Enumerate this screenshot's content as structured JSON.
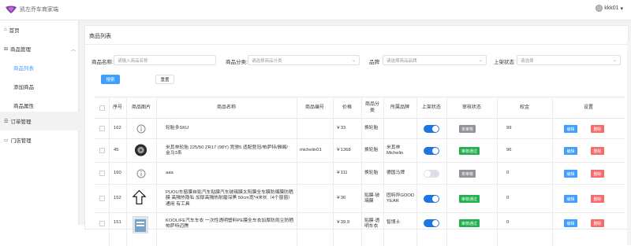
{
  "app": {
    "title": "凯左乔车商家端",
    "user": "kkk01"
  },
  "sidebar": {
    "items": [
      {
        "label": "首页",
        "icon": "home-icon"
      },
      {
        "label": "商品管理",
        "icon": "goods-icon"
      },
      {
        "label": "商品列表"
      },
      {
        "label": "添加商品"
      },
      {
        "label": "商品属性"
      },
      {
        "label": "订单管理",
        "icon": "order-icon"
      },
      {
        "label": "门店管理",
        "icon": "store-icon"
      }
    ]
  },
  "panel": {
    "title": "商品列表"
  },
  "filters": {
    "name_label": "商品名称:",
    "name_placeholder": "请输入商品名称",
    "category_label": "商品分类:",
    "category_placeholder": "请选择商品分类",
    "brand_label": "品牌",
    "brand_placeholder": "请选择商品品牌",
    "status_label": "上架状态",
    "status_placeholder": "请选择",
    "search_button": "搜索",
    "reset_button": "重置"
  },
  "table": {
    "columns": [
      "序号",
      "商品图片",
      "商品名称",
      "商品编号",
      "价格",
      "商品分类",
      "所属品牌",
      "上架状态",
      "审核状态",
      "权金",
      "设置"
    ],
    "rows": [
      {
        "id": "162",
        "name": "轮胎多SKU",
        "code": "",
        "price": "￥33",
        "category": "换轮胎",
        "brand": "",
        "on": true,
        "audit": "未审核",
        "audit_type": "gray",
        "quan": "99",
        "thumb": "info-circle-icon"
      },
      {
        "id": "45",
        "name": "米其林轮胎 225/50 ZR17 (98Y) 竞驰5 适配登冠/帕萨特/雅阁/金马3系",
        "code": "michelin01",
        "price": "￥1368",
        "category": "换轮胎",
        "brand": "米其林Michelin",
        "on": true,
        "audit": "审核通过",
        "audit_type": "green",
        "quan": "96",
        "thumb": "tire-icon"
      },
      {
        "id": "160",
        "name": "aaa",
        "code": "",
        "price": "￥111",
        "category": "换轮胎",
        "brand": "德国马牌",
        "on": false,
        "audit": "未审核",
        "audit_type": "gray",
        "quan": "0",
        "thumb": "info-circle-icon"
      },
      {
        "id": "152",
        "name": "PUOU车窗膜自贴汽车贴膜汽车玻璃膜太阳膜全车膜防爆膜防晒膜 高隔热隐私 加厚高隔热耐磨深黑 50cm宽*4米长（4个窗窗）通用 有工具",
        "code": "",
        "price": "￥36",
        "category": "贴膜-玻璃膜",
        "brand": "固特异GOOD YEAR",
        "on": true,
        "audit": "审核通过",
        "audit_type": "green",
        "quan": "0",
        "thumb": "arrow-up-icon"
      },
      {
        "id": "151",
        "name": "KOOLIFE汽车车衣 一次性透明塑料PE膜全车衣加厚防雨尘防晒 帕萨特迈腾",
        "code": "",
        "price": "￥39.9",
        "category": "贴膜-透明车衣",
        "brand": "智博士",
        "on": true,
        "audit": "审核通过",
        "audit_type": "green",
        "quan": "0",
        "thumb": "product-image"
      }
    ],
    "edit_label": "编辑",
    "delete_label": "删除"
  },
  "colors": {
    "primary": "#409eff",
    "danger": "#f56c6c",
    "success": "#23b14d",
    "switch_on": "#1f75e0"
  }
}
